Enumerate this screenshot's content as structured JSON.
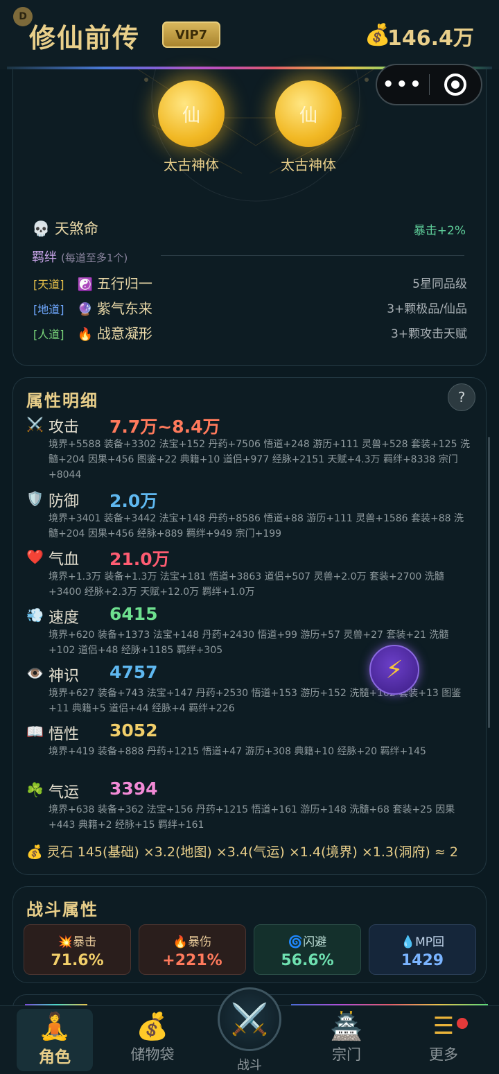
{
  "header": {
    "badge": "D",
    "title": "修仙前传",
    "vip": "VIP7",
    "money_icon": "💰",
    "money": "146.4万"
  },
  "capsule": {
    "more": "•••"
  },
  "physiques": [
    {
      "glyph": "仙",
      "label": "太古神体"
    },
    {
      "glyph": "仙",
      "label": "太古神体"
    }
  ],
  "fate": {
    "icon": "💀",
    "name": "天煞命",
    "bonus": "暴击+2%"
  },
  "bonds": {
    "title": "羁绊",
    "note": "(每道至多1个)",
    "items": [
      {
        "tag": "[天道]",
        "tag_color": "#e8c24a",
        "icon": "☯️",
        "name": "五行归一",
        "req": "5星同品级"
      },
      {
        "tag": "[地道]",
        "tag_color": "#6fa8ff",
        "icon": "🔮",
        "name": "紫气东来",
        "req": "3+颗极品/仙品"
      },
      {
        "tag": "[人道]",
        "tag_color": "#7bd67b",
        "icon": "🔥",
        "name": "战意凝形",
        "req": "3+颗攻击天赋"
      }
    ]
  },
  "attributes": {
    "title": "属性明细",
    "help": "?",
    "items": [
      {
        "icon": "⚔️",
        "name": "攻击",
        "value": "7.7万~8.4万",
        "color": "#ff7a5c",
        "detail": "境界+5588  装备+3302  法宝+152  丹药+7506  悟道+248  游历+111  灵兽+528  套装+125  洗髓+204  因果+456  图鉴+22  典籍+10  道侣+977  经脉+2151  天赋+4.3万  羁绊+8338  宗门+8044"
      },
      {
        "icon": "🛡️",
        "name": "防御",
        "value": "2.0万",
        "color": "#5fb8f0",
        "detail": "境界+3401  装备+3442  法宝+148  丹药+8586  悟道+88  游历+111  灵兽+1586  套装+88  洗髓+204  因果+456  经脉+889  羁绊+949  宗门+199"
      },
      {
        "icon": "❤️",
        "name": "气血",
        "value": "21.0万",
        "color": "#ff5c72",
        "detail": "境界+1.3万  装备+1.3万  法宝+181  悟道+3863  道侣+507  灵兽+2.0万  套装+2700  洗髓+3400  经脉+2.3万  天赋+12.0万  羁绊+1.0万"
      },
      {
        "icon": "💨",
        "name": "速度",
        "value": "6415",
        "color": "#6ee08f",
        "detail": "境界+620  装备+1373  法宝+148  丹药+2430  悟道+99  游历+57  灵兽+27  套装+21  洗髓+102  道侣+48  经脉+1185  羁绊+305"
      },
      {
        "icon": "👁️",
        "name": "神识",
        "value": "4757",
        "color": "#5fb8f0",
        "detail": "境界+627  装备+743  法宝+147  丹药+2530  悟道+153  游历+152  洗髓+102  套装+13  图鉴+11  典籍+5  道侣+44  经脉+4  羁绊+226"
      },
      {
        "icon": "📖",
        "name": "悟性",
        "value": "3052",
        "color": "#f2cf6a",
        "detail": "境界+419  装备+888  丹药+1215  悟道+47  游历+308  典籍+10  经脉+20  羁绊+145"
      },
      {
        "icon": "☘️",
        "name": "气运",
        "value": "3394",
        "color": "#f28ad6",
        "detail": "境界+638  装备+362  法宝+156  丹药+1215  悟道+161  游历+148  洗髓+68  套装+25  因果+443  典籍+2  经脉+15  羁绊+161"
      }
    ],
    "spirit_stone": "💰 灵石  145(基础) ×3.2(地图) ×3.4(气运) ×1.4(境界) ×1.3(洞府) ≈ 2"
  },
  "combat": {
    "title": "战斗属性",
    "cards": [
      {
        "icon": "💥",
        "label": "暴击",
        "value": "71.6%",
        "color": "#f2cf6a"
      },
      {
        "icon": "🔥",
        "label": "暴伤",
        "value": "+221%",
        "color": "#ff7a5c"
      },
      {
        "icon": "🌀",
        "label": "闪避",
        "value": "56.6%",
        "color": "#6ee0b0"
      },
      {
        "icon": "💧",
        "label": "MP回",
        "value": "1429",
        "color": "#7ab4ff"
      }
    ]
  },
  "nav": {
    "items": [
      {
        "icon": "🧘",
        "label": "角色"
      },
      {
        "icon": "💰",
        "label": "储物袋"
      },
      {
        "icon": "⚔️",
        "label": "战斗"
      },
      {
        "icon": "🏯",
        "label": "宗门"
      },
      {
        "icon": "☰",
        "label": "更多"
      }
    ]
  },
  "floating": {
    "bolt": "⚡"
  }
}
